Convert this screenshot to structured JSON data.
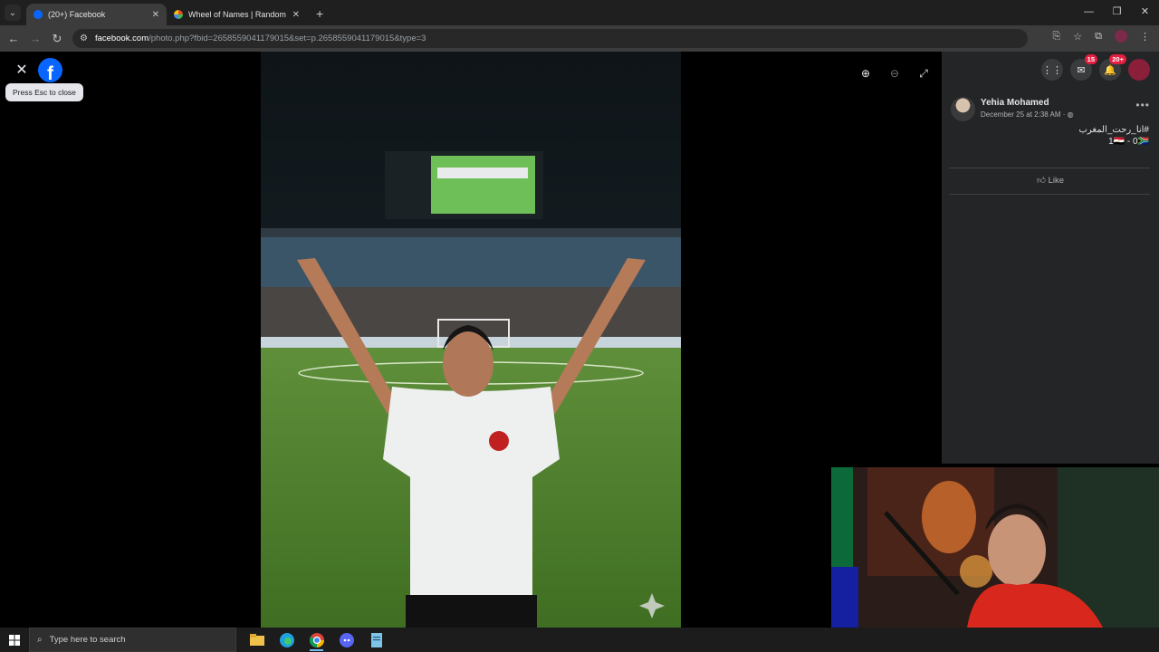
{
  "browser": {
    "tabs": [
      {
        "label": "(20+) Facebook",
        "active": true,
        "favicon_color": "#0866ff"
      },
      {
        "label": "Wheel of Names | Random nam",
        "active": false,
        "favicon_color": "#e44d26"
      }
    ],
    "new_tab": "+",
    "url_domain": "facebook.com",
    "url_path": "/photo.php?fbid=2658559041179015&set=p.2658559041179015&type=3"
  },
  "viewer": {
    "tooltip": "Press Esc to close"
  },
  "panel": {
    "messenger_badge": "15",
    "notifications_badge": "20+",
    "post": {
      "author": "Yehia Mohamed",
      "meta": "December 25 at 2:38 AM · ",
      "text_line1": "#انا_رحت_المغرب",
      "text_line2": "1🇪🇬 - 0🇿🇦"
    },
    "like_label": "Like"
  },
  "taskbar": {
    "search_placeholder": "Type here to search"
  },
  "colors": {
    "facebook_blue": "#0866ff",
    "badge_red": "#e41e3f",
    "panel_bg": "#242526"
  }
}
